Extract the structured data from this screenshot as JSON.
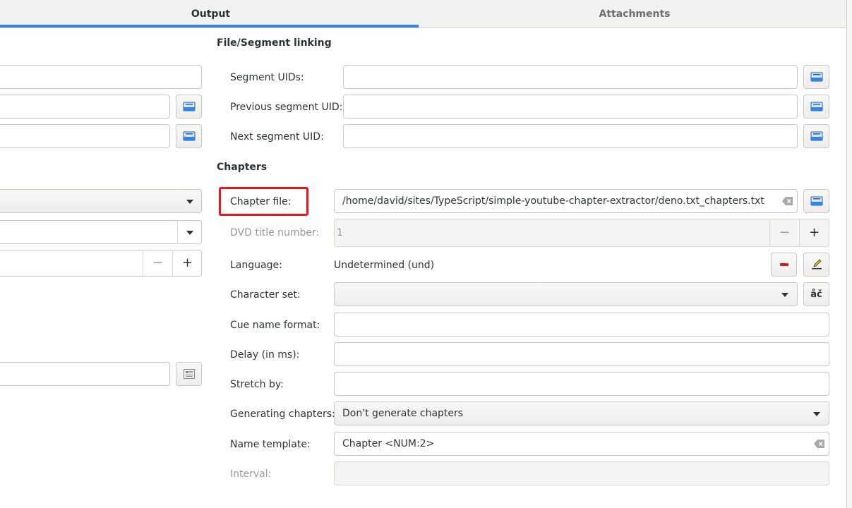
{
  "tabs": [
    {
      "label": "Output",
      "active": true
    },
    {
      "label": "Attachments",
      "active": false
    }
  ],
  "linking": {
    "title": "File/Segment linking",
    "segment_uids_label": "Segment UIDs:",
    "segment_uids_value": "",
    "previous_uid_label": "Previous segment UID:",
    "previous_uid_value": "",
    "next_uid_label": "Next segment UID:",
    "next_uid_value": ""
  },
  "chapters": {
    "title": "Chapters",
    "chapter_file_label": "Chapter file:",
    "chapter_file_value": "/home/david/sites/TypeScript/simple-youtube-chapter-extractor/deno.txt_chapters.txt",
    "dvd_title_label": "DVD title number:",
    "dvd_title_value": "1",
    "language_label": "Language:",
    "language_value": "Undetermined (und)",
    "charset_label": "Character set:",
    "charset_value": "",
    "charset_button": "åč",
    "cue_name_label": "Cue name format:",
    "cue_name_value": "",
    "delay_label": "Delay (in ms):",
    "delay_value": "",
    "stretch_label": "Stretch by:",
    "stretch_value": "",
    "generating_label": "Generating chapters:",
    "generating_value": "Don't generate chapters",
    "name_template_label": "Name template:",
    "name_template_value": "Chapter <NUM:2>",
    "interval_label": "Interval:",
    "interval_value": ""
  },
  "spin": {
    "minus": "−",
    "plus": "+"
  },
  "colors": {
    "accent": "#3584e4",
    "highlight": "#e5161c",
    "remove": "#d21e1e"
  }
}
